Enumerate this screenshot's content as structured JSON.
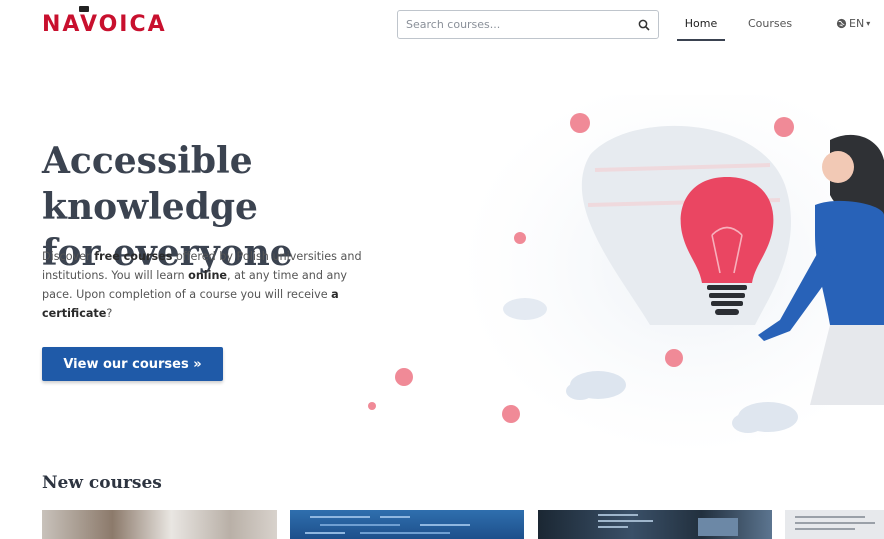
{
  "header": {
    "logo_text": "NAVOICA",
    "search_placeholder": "Search courses...",
    "nav": {
      "home": "Home",
      "courses": "Courses",
      "language": "EN"
    }
  },
  "hero": {
    "title_line1": "Accessible knowledge",
    "title_line2_prefix": "for ",
    "title_line2_highlight": "everyone",
    "text": {
      "p1": "Discover ",
      "b1": "free courses",
      "p2": " offered by Polish universities and institutions. You will learn ",
      "b2": "online",
      "p3": ", at any time and any pace. Upon completion of a course you will receive ",
      "b3": "a certificate",
      "p4": "?"
    },
    "cta_label": "View our courses »"
  },
  "new_courses": {
    "title": "New courses"
  },
  "colors": {
    "brand_red": "#c8102e",
    "button_blue": "#1f5aa8",
    "heading": "#3b4350"
  },
  "icons": [
    "search-icon",
    "globe-icon",
    "chevron-down-icon",
    "lightbulb-illustration"
  ]
}
